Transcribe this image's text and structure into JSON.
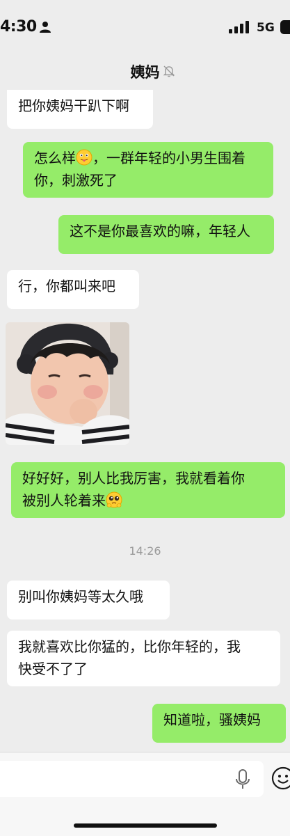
{
  "status_bar": {
    "time": "4:30",
    "network": "5G"
  },
  "header": {
    "title": "姨妈"
  },
  "messages": [
    {
      "side": "left",
      "text": "把你姨妈干趴下啊"
    },
    {
      "side": "right",
      "text": "怎么样，一群年轻的小男生围着你，刺激死了"
    },
    {
      "side": "right",
      "text": "这不是你最喜欢的嘛，年轻人"
    },
    {
      "side": "left",
      "text": "行，你都叫来吧"
    },
    {
      "side": "left",
      "type": "sticker"
    },
    {
      "side": "right",
      "text": "好好好，别人比我厉害，我就看着你被别人轮着来"
    },
    {
      "side": "left",
      "text": "别叫你姨妈等太久哦"
    },
    {
      "side": "left",
      "text": "我就喜欢比你猛的，比你年轻的，我快受不了了"
    },
    {
      "side": "right",
      "text": "知道啦，骚姨妈"
    }
  ],
  "chat": {
    "m1": "把你姨妈干趴下啊",
    "m2_line1": "怎么样",
    "m2_line1b": "，一群年轻的小男生围着",
    "m2_line2": "你，刺激死了",
    "m3": "这不是你最喜欢的嘛，年轻人",
    "m4": "行，你都叫来吧",
    "m5_line1": "好好好，别人比我厉害，我就看着你",
    "m5_line2": "被别人轮着来",
    "timestamp": "14:26",
    "m6": "别叫你姨妈等太久哦",
    "m7_line1": "我就喜欢比你猛的，比你年轻的，我",
    "m7_line2": "快受不了了",
    "m8": "知道啦，骚姨妈"
  },
  "icons": {
    "person": "person-icon",
    "signal": "signal-icon",
    "battery": "battery-icon",
    "mute": "bell-off-icon",
    "mic": "microphone-icon",
    "emoji": "smiley-icon"
  },
  "colors": {
    "background": "#ededed",
    "bubble_left": "#ffffff",
    "bubble_right": "#95ec69",
    "timestamp": "#9b9b9b"
  }
}
